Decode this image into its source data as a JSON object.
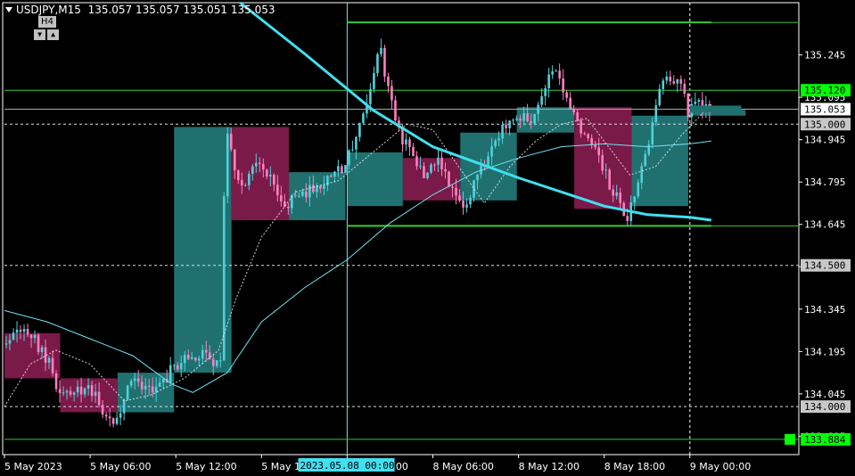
{
  "header": {
    "symbol": "USDJPY,M15",
    "ohlc": "135.057 135.057 135.051 135.053"
  },
  "timeframe_box": {
    "label": "H4",
    "down_glyph": "▼",
    "up_glyph": "▲"
  },
  "colors": {
    "background": "#000000",
    "grid": "#ffffff",
    "bull_candle": "#4fd1d9",
    "bear_candle": "#ff7fbf",
    "h4_bull_box": "#207070",
    "h4_bear_box": "#7a1a48",
    "level_lines": "#32cd32",
    "ma_thick": "#40e0f0",
    "ma_thin": "#6fe3ee",
    "price_axis_text": "#ffffff",
    "green_label_bg": "#00ff00",
    "white_label_bg": "#ffffff"
  },
  "price_labels": [
    {
      "value": 135.12,
      "text": "135.120",
      "style": "green"
    },
    {
      "value": 135.053,
      "text": "135.053",
      "style": "white"
    },
    {
      "value": 135.0,
      "text": "135.000",
      "style": "gray"
    },
    {
      "value": 134.5,
      "text": "134.500",
      "style": "gray"
    },
    {
      "value": 134.0,
      "text": "134.000",
      "style": "gray"
    },
    {
      "value": 133.884,
      "text": "133.884",
      "style": "green"
    }
  ],
  "crosshair_time_label": "2023.05.08 00:00",
  "chart_data": {
    "type": "candlestick",
    "ylim": [
      133.83,
      135.43
    ],
    "y_ticks": [
      "135.245",
      "135.095",
      "134.945",
      "134.795",
      "134.645",
      "134.495",
      "134.345",
      "134.195",
      "134.045",
      "133.895"
    ],
    "x_tick_labels": [
      "5 May 2023",
      "5 May 06:00",
      "5 May 12:00",
      "5 May 18:00",
      "8 May 00:00",
      "8 May 06:00",
      "8 May 12:00",
      "8 May 18:00",
      "9 May 00:00"
    ],
    "bars_per_tick": 24,
    "levels": [
      {
        "price": 135.36,
        "style": "solid",
        "start_tick": 4.0
      },
      {
        "price": 135.12,
        "style": "solid",
        "start_tick": 0
      },
      {
        "price": 135.053,
        "style": "solid",
        "start_tick": 0
      },
      {
        "price": 135.0,
        "style": "dashed",
        "start_tick": 0
      },
      {
        "price": 134.64,
        "style": "solid",
        "start_tick": 4.0
      },
      {
        "price": 134.5,
        "style": "dashed",
        "start_tick": 0
      },
      {
        "price": 134.0,
        "style": "dashed",
        "start_tick": 0
      },
      {
        "price": 133.884,
        "style": "solid",
        "start_tick": 0
      }
    ],
    "vlines": [
      {
        "tick": 4.0,
        "style": "solid"
      },
      {
        "tick": 8.0,
        "style": "dashed"
      }
    ],
    "h4_boxes": [
      {
        "start": 0.0,
        "end": 0.65,
        "open": 134.26,
        "close": 134.1
      },
      {
        "start": 0.65,
        "end": 1.32,
        "open": 134.1,
        "close": 133.98
      },
      {
        "start": 1.32,
        "end": 1.98,
        "open": 133.98,
        "close": 134.12
      },
      {
        "start": 1.98,
        "end": 2.65,
        "open": 134.12,
        "close": 134.99
      },
      {
        "start": 2.65,
        "end": 3.32,
        "open": 134.99,
        "close": 134.66
      },
      {
        "start": 3.32,
        "end": 3.98,
        "open": 134.66,
        "close": 134.83
      },
      {
        "start": 4.0,
        "end": 4.65,
        "open": 134.71,
        "close": 134.9
      },
      {
        "start": 4.65,
        "end": 5.32,
        "open": 134.88,
        "close": 134.73
      },
      {
        "start": 5.32,
        "end": 5.98,
        "open": 134.73,
        "close": 134.97
      },
      {
        "start": 5.98,
        "end": 6.65,
        "open": 134.97,
        "close": 135.06
      },
      {
        "start": 6.65,
        "end": 7.32,
        "open": 135.06,
        "close": 134.7
      },
      {
        "start": 7.32,
        "end": 7.98,
        "open": 134.71,
        "close": 135.03
      },
      {
        "start": 7.98,
        "end": 8.65,
        "open": 135.03,
        "close": 135.05
      }
    ],
    "price_path": [
      {
        "t": 0.0,
        "p": 134.22
      },
      {
        "t": 0.3,
        "p": 134.27
      },
      {
        "t": 0.5,
        "p": 134.18
      },
      {
        "t": 0.7,
        "p": 134.03
      },
      {
        "t": 1.0,
        "p": 134.08
      },
      {
        "t": 1.3,
        "p": 133.92
      },
      {
        "t": 1.5,
        "p": 134.1
      },
      {
        "t": 1.8,
        "p": 134.05
      },
      {
        "t": 2.0,
        "p": 134.15
      },
      {
        "t": 2.3,
        "p": 134.18
      },
      {
        "t": 2.55,
        "p": 134.15
      },
      {
        "t": 2.6,
        "p": 135.02
      },
      {
        "t": 2.75,
        "p": 134.78
      },
      {
        "t": 3.0,
        "p": 134.85
      },
      {
        "t": 3.3,
        "p": 134.72
      },
      {
        "t": 3.6,
        "p": 134.77
      },
      {
        "t": 3.95,
        "p": 134.84
      },
      {
        "t": 4.25,
        "p": 135.05
      },
      {
        "t": 4.4,
        "p": 135.27
      },
      {
        "t": 4.6,
        "p": 134.98
      },
      {
        "t": 4.9,
        "p": 134.83
      },
      {
        "t": 5.1,
        "p": 134.86
      },
      {
        "t": 5.4,
        "p": 134.7
      },
      {
        "t": 5.7,
        "p": 134.93
      },
      {
        "t": 5.9,
        "p": 135.02
      },
      {
        "t": 6.2,
        "p": 135.02
      },
      {
        "t": 6.45,
        "p": 135.22
      },
      {
        "t": 6.6,
        "p": 135.06
      },
      {
        "t": 6.9,
        "p": 134.92
      },
      {
        "t": 7.1,
        "p": 134.78
      },
      {
        "t": 7.3,
        "p": 134.67
      },
      {
        "t": 7.5,
        "p": 134.9
      },
      {
        "t": 7.7,
        "p": 135.15
      },
      {
        "t": 7.9,
        "p": 135.14
      },
      {
        "t": 8.0,
        "p": 135.05
      },
      {
        "t": 8.2,
        "p": 135.07
      },
      {
        "t": 8.25,
        "p": 135.053
      }
    ],
    "candle_seed": 20230508,
    "ma_slow": [
      {
        "t": 2.75,
        "p": 135.43
      },
      {
        "t": 3.5,
        "p": 135.25
      },
      {
        "t": 4.3,
        "p": 135.05
      },
      {
        "t": 5.0,
        "p": 134.92
      },
      {
        "t": 6.0,
        "p": 134.81
      },
      {
        "t": 7.0,
        "p": 134.71
      },
      {
        "t": 7.5,
        "p": 134.68
      },
      {
        "t": 8.0,
        "p": 134.67
      },
      {
        "t": 8.25,
        "p": 134.66
      }
    ],
    "ma_mid": [
      {
        "t": 0.0,
        "p": 134.34
      },
      {
        "t": 0.5,
        "p": 134.3
      },
      {
        "t": 1.0,
        "p": 134.24
      },
      {
        "t": 1.5,
        "p": 134.18
      },
      {
        "t": 1.95,
        "p": 134.08
      },
      {
        "t": 2.2,
        "p": 134.05
      },
      {
        "t": 2.6,
        "p": 134.12
      },
      {
        "t": 3.0,
        "p": 134.3
      },
      {
        "t": 3.5,
        "p": 134.42
      },
      {
        "t": 4.0,
        "p": 134.52
      },
      {
        "t": 4.5,
        "p": 134.65
      },
      {
        "t": 5.0,
        "p": 134.75
      },
      {
        "t": 5.5,
        "p": 134.83
      },
      {
        "t": 6.0,
        "p": 134.88
      },
      {
        "t": 6.5,
        "p": 134.92
      },
      {
        "t": 7.0,
        "p": 134.93
      },
      {
        "t": 7.5,
        "p": 134.92
      },
      {
        "t": 8.0,
        "p": 134.93
      },
      {
        "t": 8.25,
        "p": 134.94
      }
    ],
    "ma_fast": [
      {
        "t": 0.0,
        "p": 134.0
      },
      {
        "t": 0.3,
        "p": 134.15
      },
      {
        "t": 0.6,
        "p": 134.2
      },
      {
        "t": 1.0,
        "p": 134.15
      },
      {
        "t": 1.4,
        "p": 134.02
      },
      {
        "t": 1.7,
        "p": 134.04
      },
      {
        "t": 2.1,
        "p": 134.1
      },
      {
        "t": 2.5,
        "p": 134.2
      },
      {
        "t": 2.7,
        "p": 134.38
      },
      {
        "t": 3.0,
        "p": 134.6
      },
      {
        "t": 3.4,
        "p": 134.76
      },
      {
        "t": 3.9,
        "p": 134.8
      },
      {
        "t": 4.3,
        "p": 134.9
      },
      {
        "t": 4.7,
        "p": 135.0
      },
      {
        "t": 5.0,
        "p": 134.98
      },
      {
        "t": 5.3,
        "p": 134.85
      },
      {
        "t": 5.6,
        "p": 134.72
      },
      {
        "t": 5.9,
        "p": 134.85
      },
      {
        "t": 6.2,
        "p": 134.94
      },
      {
        "t": 6.5,
        "p": 135.0
      },
      {
        "t": 6.8,
        "p": 135.02
      },
      {
        "t": 7.0,
        "p": 134.94
      },
      {
        "t": 7.3,
        "p": 134.82
      },
      {
        "t": 7.6,
        "p": 134.85
      },
      {
        "t": 7.9,
        "p": 134.96
      },
      {
        "t": 8.25,
        "p": 135.07
      }
    ]
  }
}
